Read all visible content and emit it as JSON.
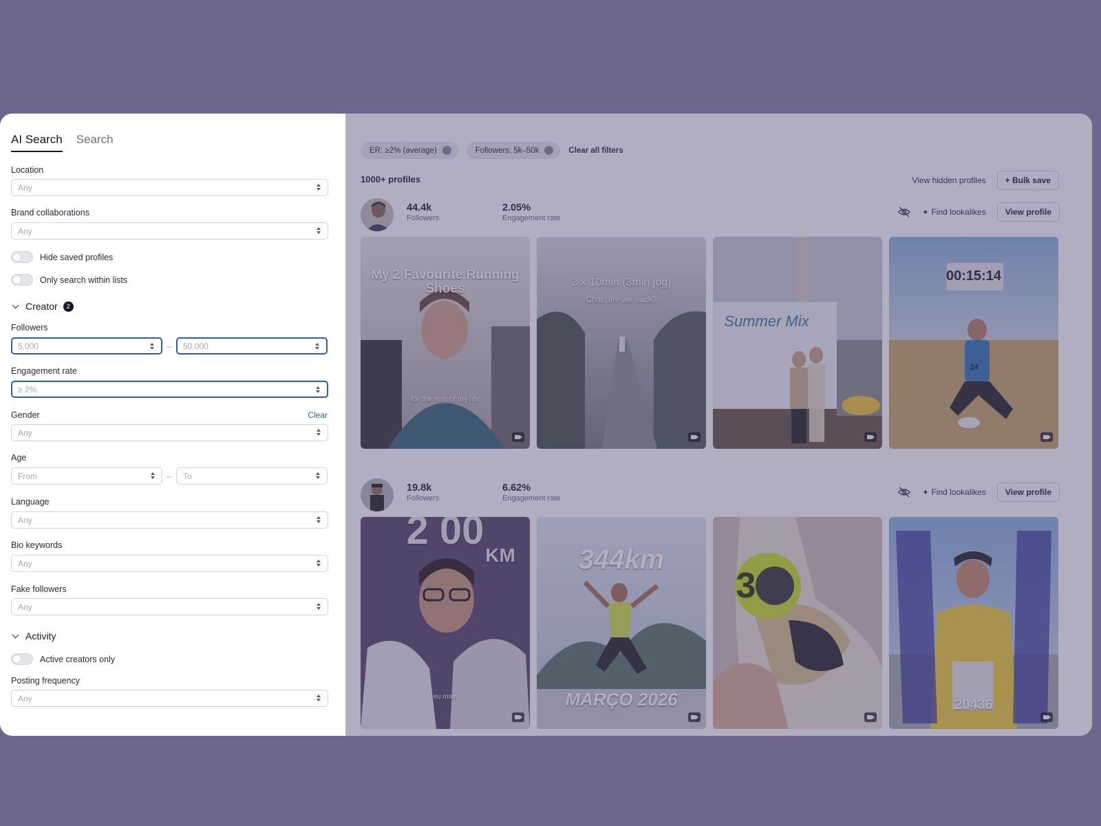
{
  "tabs": [
    {
      "label": "AI Search",
      "active": true
    },
    {
      "label": "Search",
      "active": false
    }
  ],
  "filters": {
    "location": {
      "label": "Location",
      "placeholder": "Any"
    },
    "brand_collaborations": {
      "label": "Brand collaborations",
      "placeholder": "Any"
    },
    "hide_saved": {
      "label": "Hide saved profiles",
      "on": false
    },
    "only_lists": {
      "label": "Only search within lists",
      "on": false
    },
    "creator_section": {
      "label": "Creator",
      "count": "2"
    },
    "followers": {
      "label": "Followers",
      "min": "5,000",
      "max": "50,000",
      "separator": "–"
    },
    "engagement_rate": {
      "label": "Engagement rate",
      "value": "≥ 2%"
    },
    "gender": {
      "label": "Gender",
      "clear": "Clear",
      "placeholder": "Any"
    },
    "age": {
      "label": "Age",
      "from": "From",
      "to": "To",
      "separator": "–"
    },
    "language": {
      "label": "Language",
      "placeholder": "Any"
    },
    "bio_keywords": {
      "label": "Bio keywords",
      "placeholder": "Any"
    },
    "fake_followers": {
      "label": "Fake followers",
      "placeholder": "Any"
    },
    "activity_section": {
      "label": "Activity"
    },
    "active_only": {
      "label": "Active creators only",
      "on": false
    },
    "posting_frequency": {
      "label": "Posting frequency",
      "placeholder": "Any"
    }
  },
  "results": {
    "chips": [
      {
        "label": "ER: ≥2% (average)"
      },
      {
        "label": "Followers: 5k–50k"
      }
    ],
    "clear_all": "Clear all filters",
    "count": "1000+ profiles",
    "view_hidden": "View hidden profiles",
    "bulk_save": "+ Bulk save",
    "creators": [
      {
        "followers": "44.4k",
        "followers_label": "Followers",
        "engagement": "2.05%",
        "engagement_label": "Engagement rate",
        "find_lookalikes": "Find lookalikes",
        "view_profile": "View profile",
        "thumbs": [
          {
            "title": "My 2 Favourite Running Shoes",
            "caption": "for the rest of my life"
          },
          {
            "title": "3 x 10min (3min jog)",
            "caption": "Chat, are we back?"
          },
          {
            "title": "Summer Mix",
            "caption": ""
          },
          {
            "title": "00:15:14",
            "caption": "24"
          }
        ]
      },
      {
        "followers": "19.8k",
        "followers_label": "Followers",
        "engagement": "6.62%",
        "engagement_label": "Engagement rate",
        "find_lookalikes": "Find lookalikes",
        "view_profile": "View profile",
        "thumbs": [
          {
            "title": "2 00",
            "caption": "KM",
            "sub": "eu mais"
          },
          {
            "title": "344km",
            "caption": "MARÇO 2026"
          },
          {
            "title": "3",
            "caption": ""
          },
          {
            "title": "20436",
            "caption": ""
          }
        ]
      }
    ]
  }
}
